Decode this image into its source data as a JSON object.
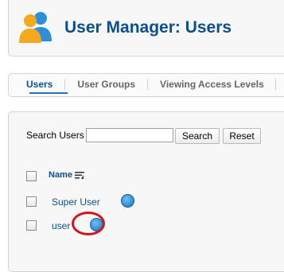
{
  "header": {
    "title": "User Manager: Users"
  },
  "tabs": [
    {
      "label": "Users",
      "active": true
    },
    {
      "label": "User Groups",
      "active": false
    },
    {
      "label": "Viewing Access Levels",
      "active": false
    }
  ],
  "search": {
    "label": "Search Users",
    "value": "",
    "search_button": "Search",
    "reset_button": "Reset"
  },
  "table": {
    "name_header": "Name",
    "rows": [
      {
        "name": "Super User",
        "icon": "link-icon"
      },
      {
        "name": "user",
        "icon": "link-icon"
      }
    ]
  },
  "colors": {
    "accent": "#0d4f8b",
    "highlight": "#d2141c"
  }
}
